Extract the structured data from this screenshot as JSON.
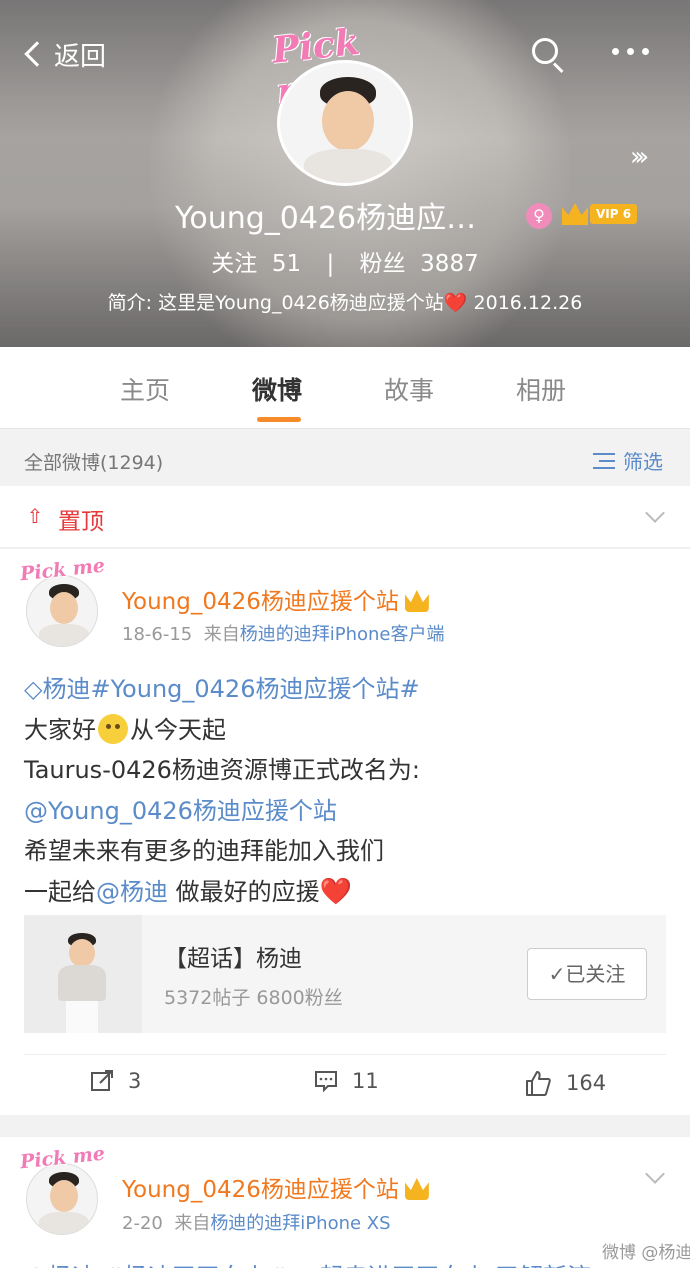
{
  "header": {
    "back_label": "返回",
    "avatar_badge_text": "Pick me",
    "profile_name": "Young_0426杨迪应…",
    "vip_level": "VIP 6",
    "following_label": "关注",
    "following_count": "51",
    "stats_separator": "|",
    "followers_label": "粉丝",
    "followers_count": "3887",
    "intro": "简介: 这里是Young_0426杨迪应援个站",
    "intro_heart": "❤️",
    "intro_date": "2016.12.26"
  },
  "tabs": [
    {
      "label": "主页"
    },
    {
      "label": "微博"
    },
    {
      "label": "故事"
    },
    {
      "label": "相册"
    }
  ],
  "filter_bar": {
    "count_label": "全部微博(1294)",
    "filter_label": "筛选"
  },
  "pinned": {
    "label": "置顶"
  },
  "post1": {
    "avatar_badge_text": "Pick me",
    "author": "Young_0426杨迪应援个站",
    "date": "18-6-15",
    "source_prefix": "来自",
    "source": "杨迪的迪拜iPhone客户端",
    "lines": {
      "topic": "杨迪#Young_0426杨迪应援个站#",
      "line2a": "大家好",
      "line2b": "从今天起",
      "line3": "Taurus-0426杨迪资源博正式改名为:",
      "line4": "@Young_0426杨迪应援个站",
      "line5": "希望未来有更多的迪拜能加入我们",
      "line6a": "一起给",
      "line6b": "@杨迪",
      "line6c": " 做最好的应援",
      "heart": "❤️"
    },
    "supertopic": {
      "title": "【超话】杨迪",
      "stats": "5372帖子 6800粉丝",
      "follow_label": "✓已关注"
    },
    "actions": {
      "repost": "3",
      "comment": "11",
      "like": "164"
    }
  },
  "post2": {
    "avatar_badge_text": "Pick me",
    "author": "Young_0426杨迪应援个站",
    "date": "2-20",
    "source_prefix": "来自",
    "source": "杨迪的迪拜iPhone XS",
    "partial_line": "@杨迪 #杨迪天天向上# 一起走进天天向上 了解新济"
  },
  "watermark": "微博 @杨迪"
}
